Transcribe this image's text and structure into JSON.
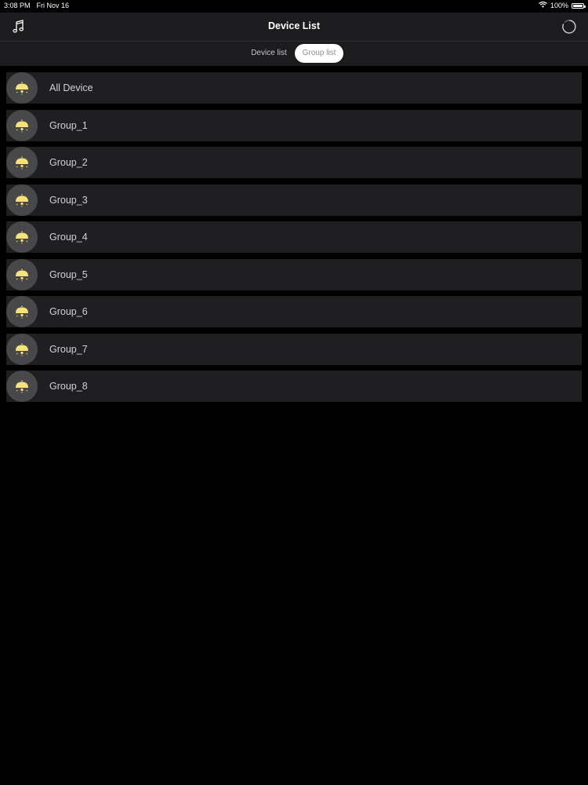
{
  "status_bar": {
    "time": "3:08 PM",
    "date": "Fri Nov 16",
    "battery_text": "100%",
    "battery_level": 1.0,
    "wifi_icon": "wifi-icon",
    "battery_icon": "battery-icon"
  },
  "nav": {
    "title": "Device List",
    "left_icon": "music-note-icon",
    "right_icon": "loading-spinner-icon"
  },
  "segments": {
    "device_list": "Device list",
    "group_list": "Group list",
    "selected": "Group list"
  },
  "colors": {
    "background": "#000000",
    "bar": "#1c1c1e",
    "row": "#1f1f21",
    "icon_circle": "#48484a",
    "bulb": "#f5e27a"
  },
  "groups": [
    {
      "label": "All Device",
      "icon": "lamp-icon"
    },
    {
      "label": "Group_1",
      "icon": "lamp-icon"
    },
    {
      "label": "Group_2",
      "icon": "lamp-icon"
    },
    {
      "label": "Group_3",
      "icon": "lamp-icon"
    },
    {
      "label": "Group_4",
      "icon": "lamp-icon"
    },
    {
      "label": "Group_5",
      "icon": "lamp-icon"
    },
    {
      "label": "Group_6",
      "icon": "lamp-icon"
    },
    {
      "label": "Group_7",
      "icon": "lamp-icon"
    },
    {
      "label": "Group_8",
      "icon": "lamp-icon"
    }
  ]
}
